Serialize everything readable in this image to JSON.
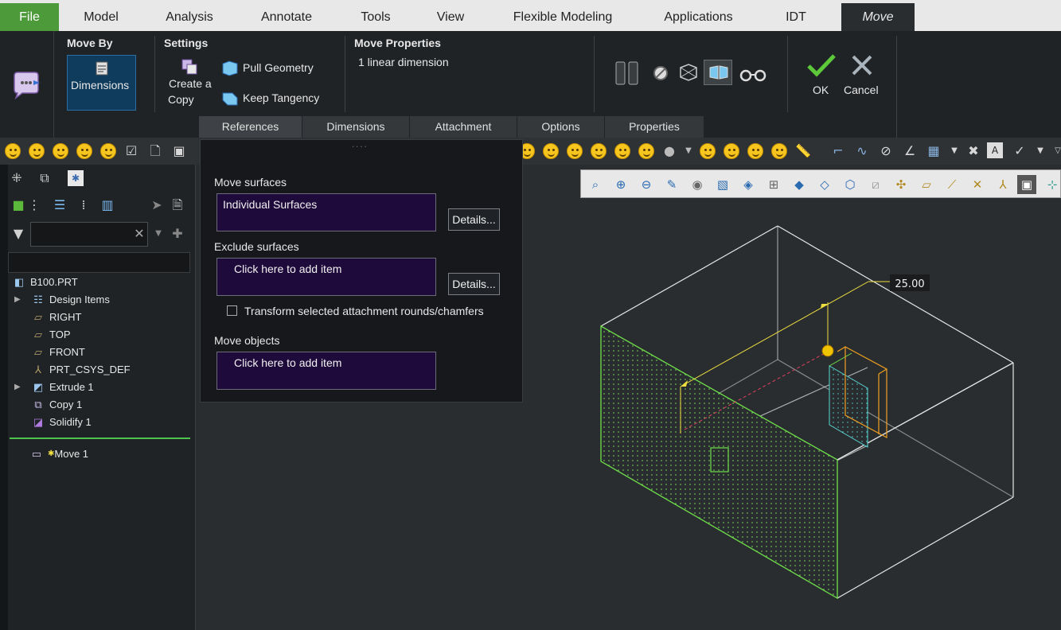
{
  "ribbon_tabs": [
    "File",
    "Model",
    "Analysis",
    "Annotate",
    "Tools",
    "View",
    "Flexible Modeling",
    "Applications",
    "IDT",
    "Move"
  ],
  "ribbon": {
    "move_by_title": "Move By",
    "dimensions_label": "Dimensions",
    "settings_title": "Settings",
    "create_copy_line1": "Create a",
    "create_copy_line2": "Copy",
    "pull_geometry": "Pull Geometry",
    "keep_tangency": "Keep Tangency",
    "move_properties_title": "Move Properties",
    "move_properties_value": "1 linear dimension",
    "ok_label": "OK",
    "cancel_label": "Cancel"
  },
  "sub_tabs": [
    "References",
    "Dimensions",
    "Attachment",
    "Options",
    "Properties"
  ],
  "references_panel": {
    "move_surfaces_label": "Move surfaces",
    "move_surfaces_value": "Individual Surfaces",
    "details_label": "Details...",
    "exclude_surfaces_label": "Exclude surfaces",
    "exclude_surfaces_value": "Click here to add item",
    "transform_label": "Transform selected attachment rounds/chamfers",
    "transform_checked": false,
    "move_objects_label": "Move objects",
    "move_objects_value": "Click here to add item"
  },
  "model_tree": {
    "filter_value": "",
    "items": [
      {
        "label": "B100.PRT",
        "icon": "part-icon"
      },
      {
        "label": "Design Items",
        "icon": "design-items-icon"
      },
      {
        "label": "RIGHT",
        "icon": "datum-plane-icon"
      },
      {
        "label": "TOP",
        "icon": "datum-plane-icon"
      },
      {
        "label": "FRONT",
        "icon": "datum-plane-icon"
      },
      {
        "label": "PRT_CSYS_DEF",
        "icon": "csys-icon"
      },
      {
        "label": "Extrude 1",
        "icon": "extrude-icon"
      },
      {
        "label": "Copy 1",
        "icon": "copy-icon"
      },
      {
        "label": "Solidify 1",
        "icon": "solidify-icon"
      },
      {
        "label": "Move 1",
        "icon": "move-feature-icon"
      }
    ]
  },
  "graphics": {
    "dimension_value": "25.00"
  },
  "colors": {
    "file_tab": "#4d9a3b",
    "selection_green": "#6fe04a",
    "dimension_yellow": "#f0c400",
    "ref_box_bg": "#1f0a3c"
  }
}
